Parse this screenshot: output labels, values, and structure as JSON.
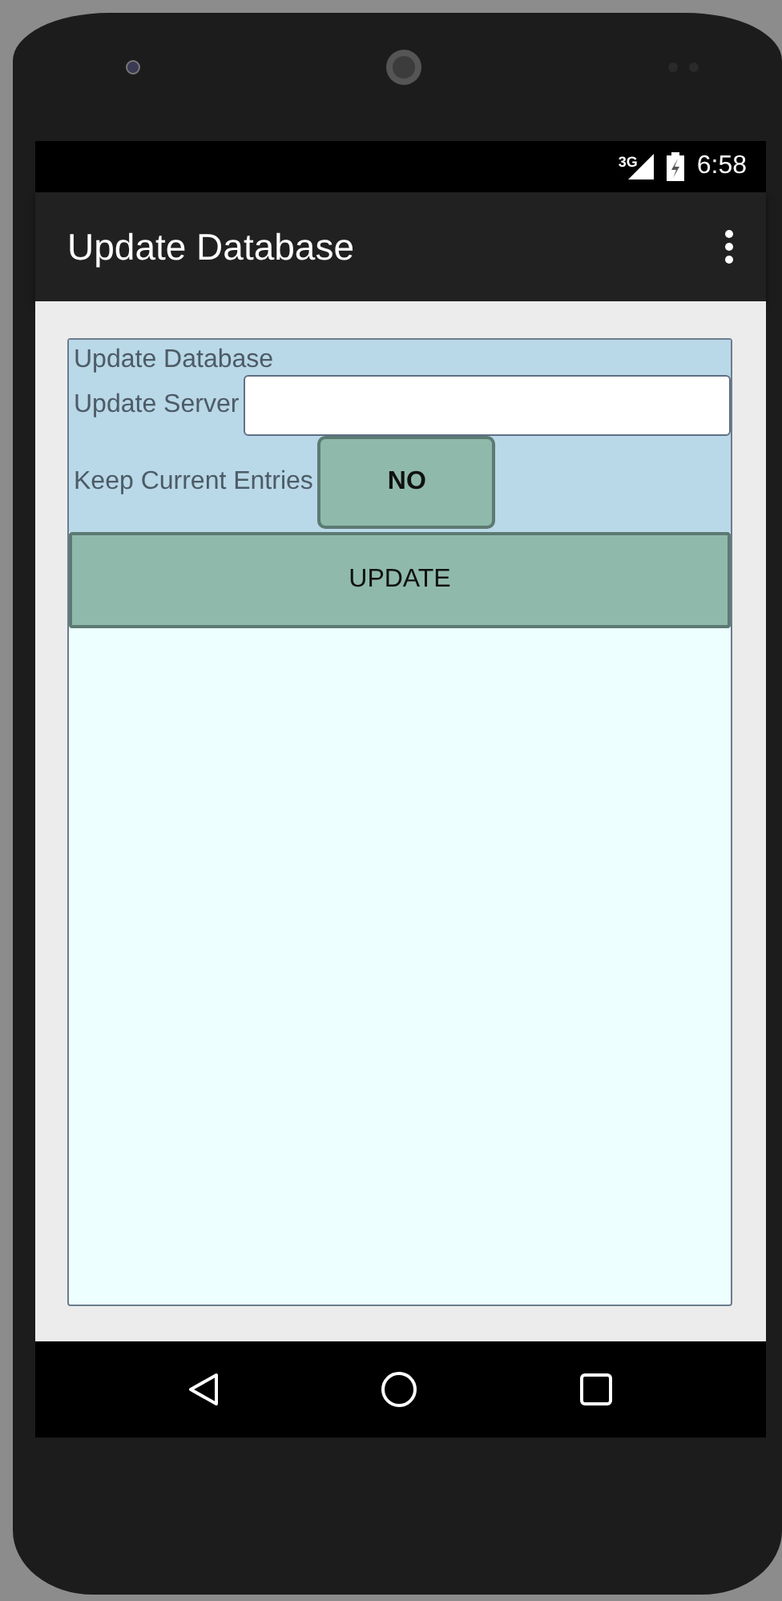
{
  "status_bar": {
    "network": "3G",
    "time": "6:58"
  },
  "app_bar": {
    "title": "Update Database"
  },
  "form": {
    "title": "Update Database",
    "server": {
      "label": "Update Server"
    },
    "keep_entries": {
      "label": "Keep Current Entries",
      "button": "NO"
    },
    "update_button": "UPDATE"
  }
}
